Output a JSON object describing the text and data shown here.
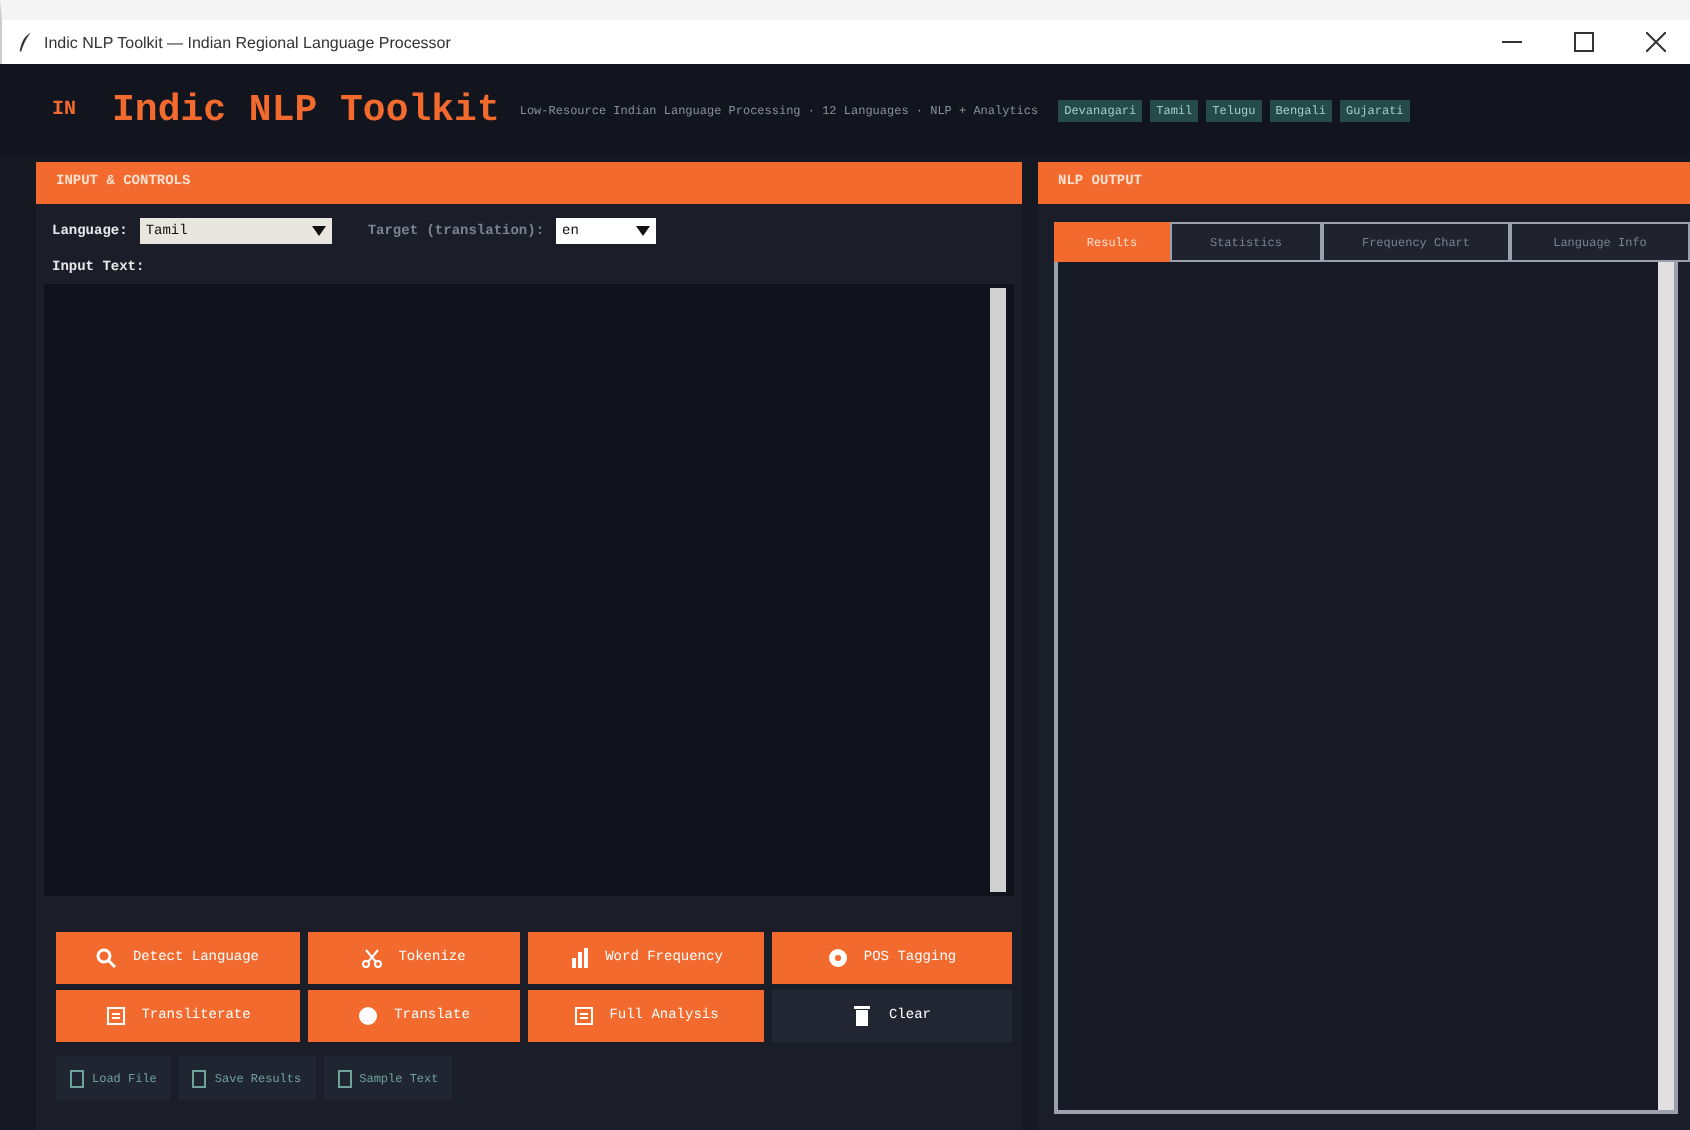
{
  "window": {
    "title": "Indic NLP Toolkit — Indian Regional Language Processor"
  },
  "header": {
    "logo": "IN",
    "title": "Indic NLP Toolkit",
    "subtitle": "Low-Resource Indian Language Processing · 12 Languages · NLP + Analytics",
    "badges": [
      "Devanagari",
      "Tamil",
      "Telugu",
      "Bengali",
      "Gujarati"
    ]
  },
  "input_panel": {
    "title": "INPUT & CONTROLS",
    "language_label": "Language:",
    "language": "Tamil",
    "target_label": "Target (translation):",
    "target": "en",
    "input_label": "Input Text:"
  },
  "actions": [
    {
      "label": "Detect Language",
      "kind": "primary"
    },
    {
      "label": "Tokenize",
      "kind": "primary"
    },
    {
      "label": "Word Frequency",
      "kind": "primary"
    },
    {
      "label": "POS Tagging",
      "kind": "primary"
    },
    {
      "label": "Transliterate",
      "kind": "primary"
    },
    {
      "label": "Translate",
      "kind": "primary"
    },
    {
      "label": "Full Analysis",
      "kind": "primary"
    },
    {
      "label": "Clear",
      "kind": "dark"
    }
  ],
  "file_actions": [
    "Load File",
    "Save Results",
    "Sample Text"
  ],
  "output_panel": {
    "title": "NLP OUTPUT",
    "tabs": [
      {
        "label": "Results",
        "selected": true
      },
      {
        "label": "Statistics",
        "selected": false
      },
      {
        "label": "Frequency Chart",
        "selected": false
      },
      {
        "label": "Language Info",
        "selected": false
      }
    ]
  }
}
